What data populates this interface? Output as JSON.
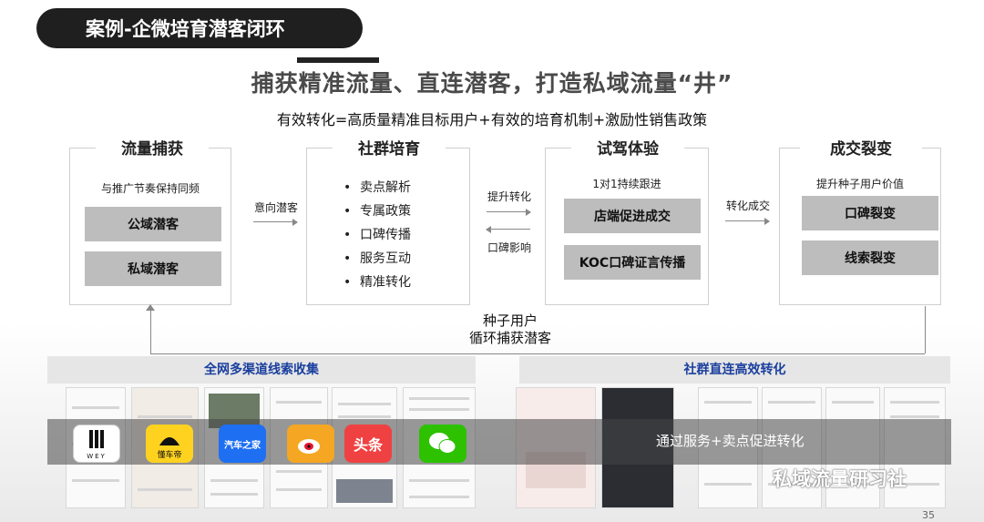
{
  "title_pill": "案例-企微培育潜客闭环",
  "headline": "捕获精准流量、直连潜客，打造私域流量“井”",
  "formula": "有效转化=高质量精准目标用户+有效的培育机制+激励性销售政策",
  "stages": [
    {
      "title": "流量捕获",
      "note": "与推广节奏保持同频",
      "boxes": [
        "公域潜客",
        "私域潜客"
      ]
    },
    {
      "title": "社群培育",
      "bullets": [
        "卖点解析",
        "专属政策",
        "口碑传播",
        "服务互动",
        "精准转化"
      ]
    },
    {
      "title": "试驾体验",
      "note": "1对1持续跟进",
      "boxes": [
        "店端促进成交",
        "KOC口碑证言传播"
      ]
    },
    {
      "title": "成交裂变",
      "note": "提升种子用户价值",
      "boxes": [
        "口碑裂变",
        "线索裂变"
      ]
    }
  ],
  "arrows": {
    "a1": "意向潜客",
    "a2_top": "提升转化",
    "a2_bottom": "口碑影响",
    "a3": "转化成交"
  },
  "loop": {
    "line1": "种子用户",
    "line2": "循环捕获潜客"
  },
  "bottom": {
    "left_title": "全网多渠道线索收集",
    "right_title": "社群直连高效转化",
    "overlay_text": "通过服务+卖点促进转化",
    "apps": [
      {
        "label": "WEY",
        "color": "#ffffff",
        "fg": "#111111",
        "icon": "wey-logo-icon"
      },
      {
        "label": "懂车帝",
        "color": "#ffd21f",
        "fg": "#111111",
        "icon": "dongchedi-logo-icon"
      },
      {
        "label": "汽车之家",
        "color": "#1e6ff2",
        "fg": "#ffffff",
        "icon": "autohome-logo-icon"
      },
      {
        "label": "",
        "color": "#f5a623",
        "fg": "#e6162d",
        "icon": "weibo-logo-icon"
      },
      {
        "label": "头条",
        "color": "#f04142",
        "fg": "#ffffff",
        "icon": "toutiao-logo-icon"
      },
      {
        "label": "",
        "color": "#2dc100",
        "fg": "#ffffff",
        "icon": "wechat-logo-icon"
      }
    ]
  },
  "watermark": "私域流量研习社",
  "page_number": "35"
}
